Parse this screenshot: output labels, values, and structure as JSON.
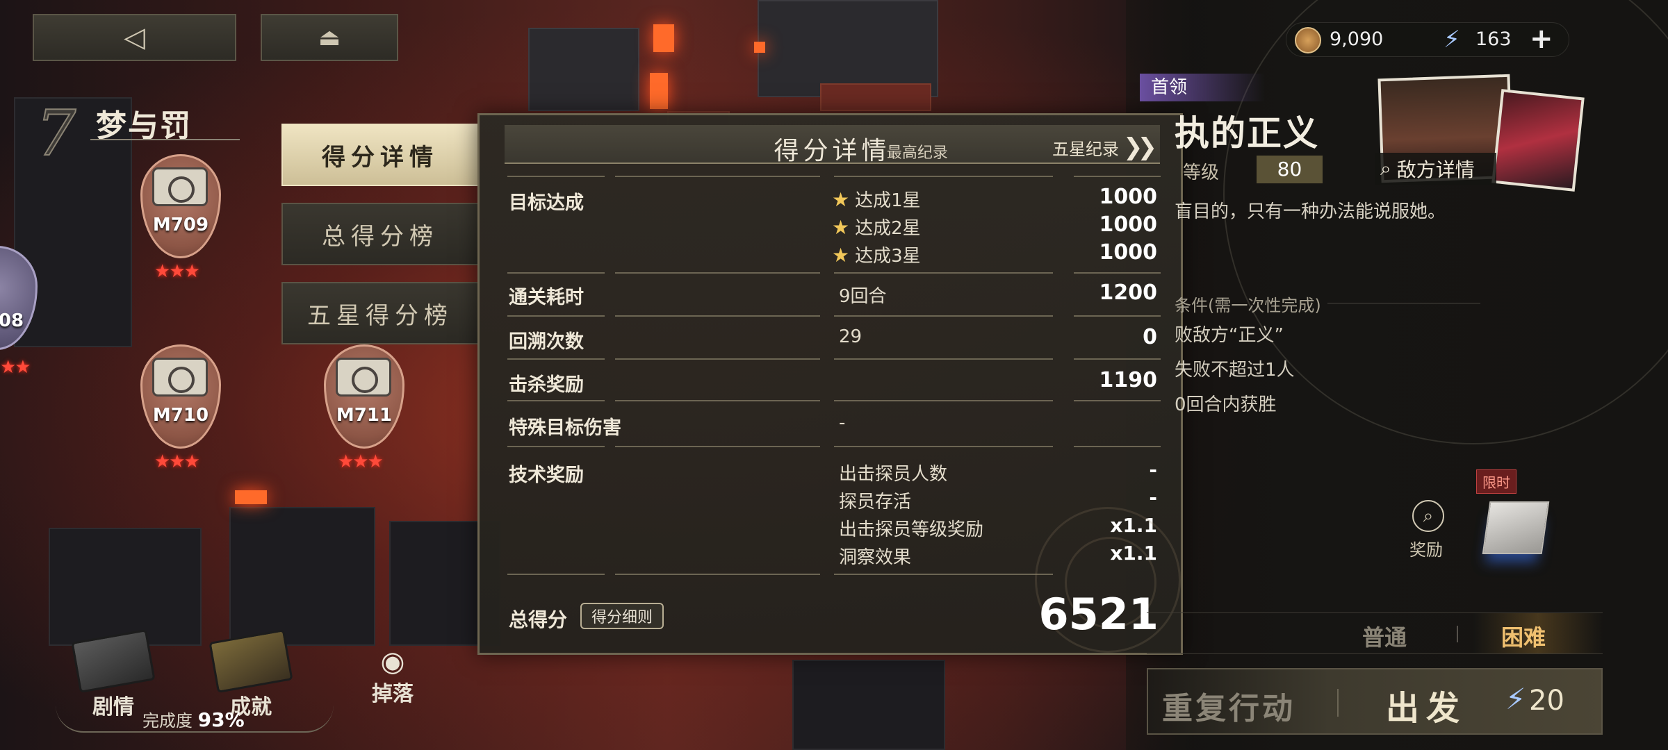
{
  "top_buttons": {
    "back_icon": "back-triangle-icon",
    "home_icon": "stack-home-icon"
  },
  "chapter": {
    "number": "7",
    "title": "梦与罚"
  },
  "stages": [
    {
      "code": "M709",
      "stars": "★★★"
    },
    {
      "code": "M710",
      "stars": "★★★"
    },
    {
      "code": "M711",
      "stars": "★★★"
    },
    {
      "code": "08",
      "stars": "★★"
    }
  ],
  "tabs": [
    {
      "label": "得分详情",
      "active": true
    },
    {
      "label": "总得分榜",
      "active": false
    },
    {
      "label": "五星得分榜",
      "active": false
    }
  ],
  "score_panel": {
    "title": "得分详情",
    "subtitle": "- 最高纪录",
    "five_star_link": "五星纪录",
    "rows": {
      "target": {
        "label": "目标达成",
        "items": [
          {
            "text": "达成1星",
            "value": "1000"
          },
          {
            "text": "达成2星",
            "value": "1000"
          },
          {
            "text": "达成3星",
            "value": "1000"
          }
        ]
      },
      "clear_time": {
        "label": "通关耗时",
        "mid": "9回合",
        "value": "1200"
      },
      "rewind": {
        "label": "回溯次数",
        "mid": "29",
        "value": "0"
      },
      "kill": {
        "label": "击杀奖励",
        "value": "1190"
      },
      "special": {
        "label": "特殊目标伤害",
        "mid": "-"
      },
      "tech": {
        "label": "技术奖励",
        "items": [
          {
            "text": "出击探员人数",
            "value": "-"
          },
          {
            "text": "探员存活",
            "value": "-"
          },
          {
            "text": "出击探员等级奖励",
            "value": "x1.1"
          },
          {
            "text": "洞察效果",
            "value": "x1.1"
          }
        ]
      }
    },
    "total_label": "总得分",
    "rules_button": "得分细则",
    "total_value": "6521"
  },
  "resources": {
    "coins": "9,090",
    "energy": "163"
  },
  "boss": {
    "tag": "首领",
    "name": "执的正义",
    "level_label": "等级",
    "level": "80",
    "description": "盲目的，只有一种办法能说服她。",
    "enemy_details": "敌方详情",
    "conditions_title": "条件(需一次性完成)",
    "conditions": [
      "败敌方“正义”",
      "失败不超过1人",
      "0回合内获胜"
    ]
  },
  "reward": {
    "label": "奖励",
    "limited_tag": "限时"
  },
  "difficulty": {
    "normal": "普通",
    "hard": "困难"
  },
  "actions": {
    "repeat": "重复行动",
    "depart": "出发",
    "cost": "20"
  },
  "bottom_menu": {
    "story": "剧情",
    "achievement": "成就",
    "drops": "掉落",
    "completion_label": "完成度",
    "completion": "93%"
  }
}
